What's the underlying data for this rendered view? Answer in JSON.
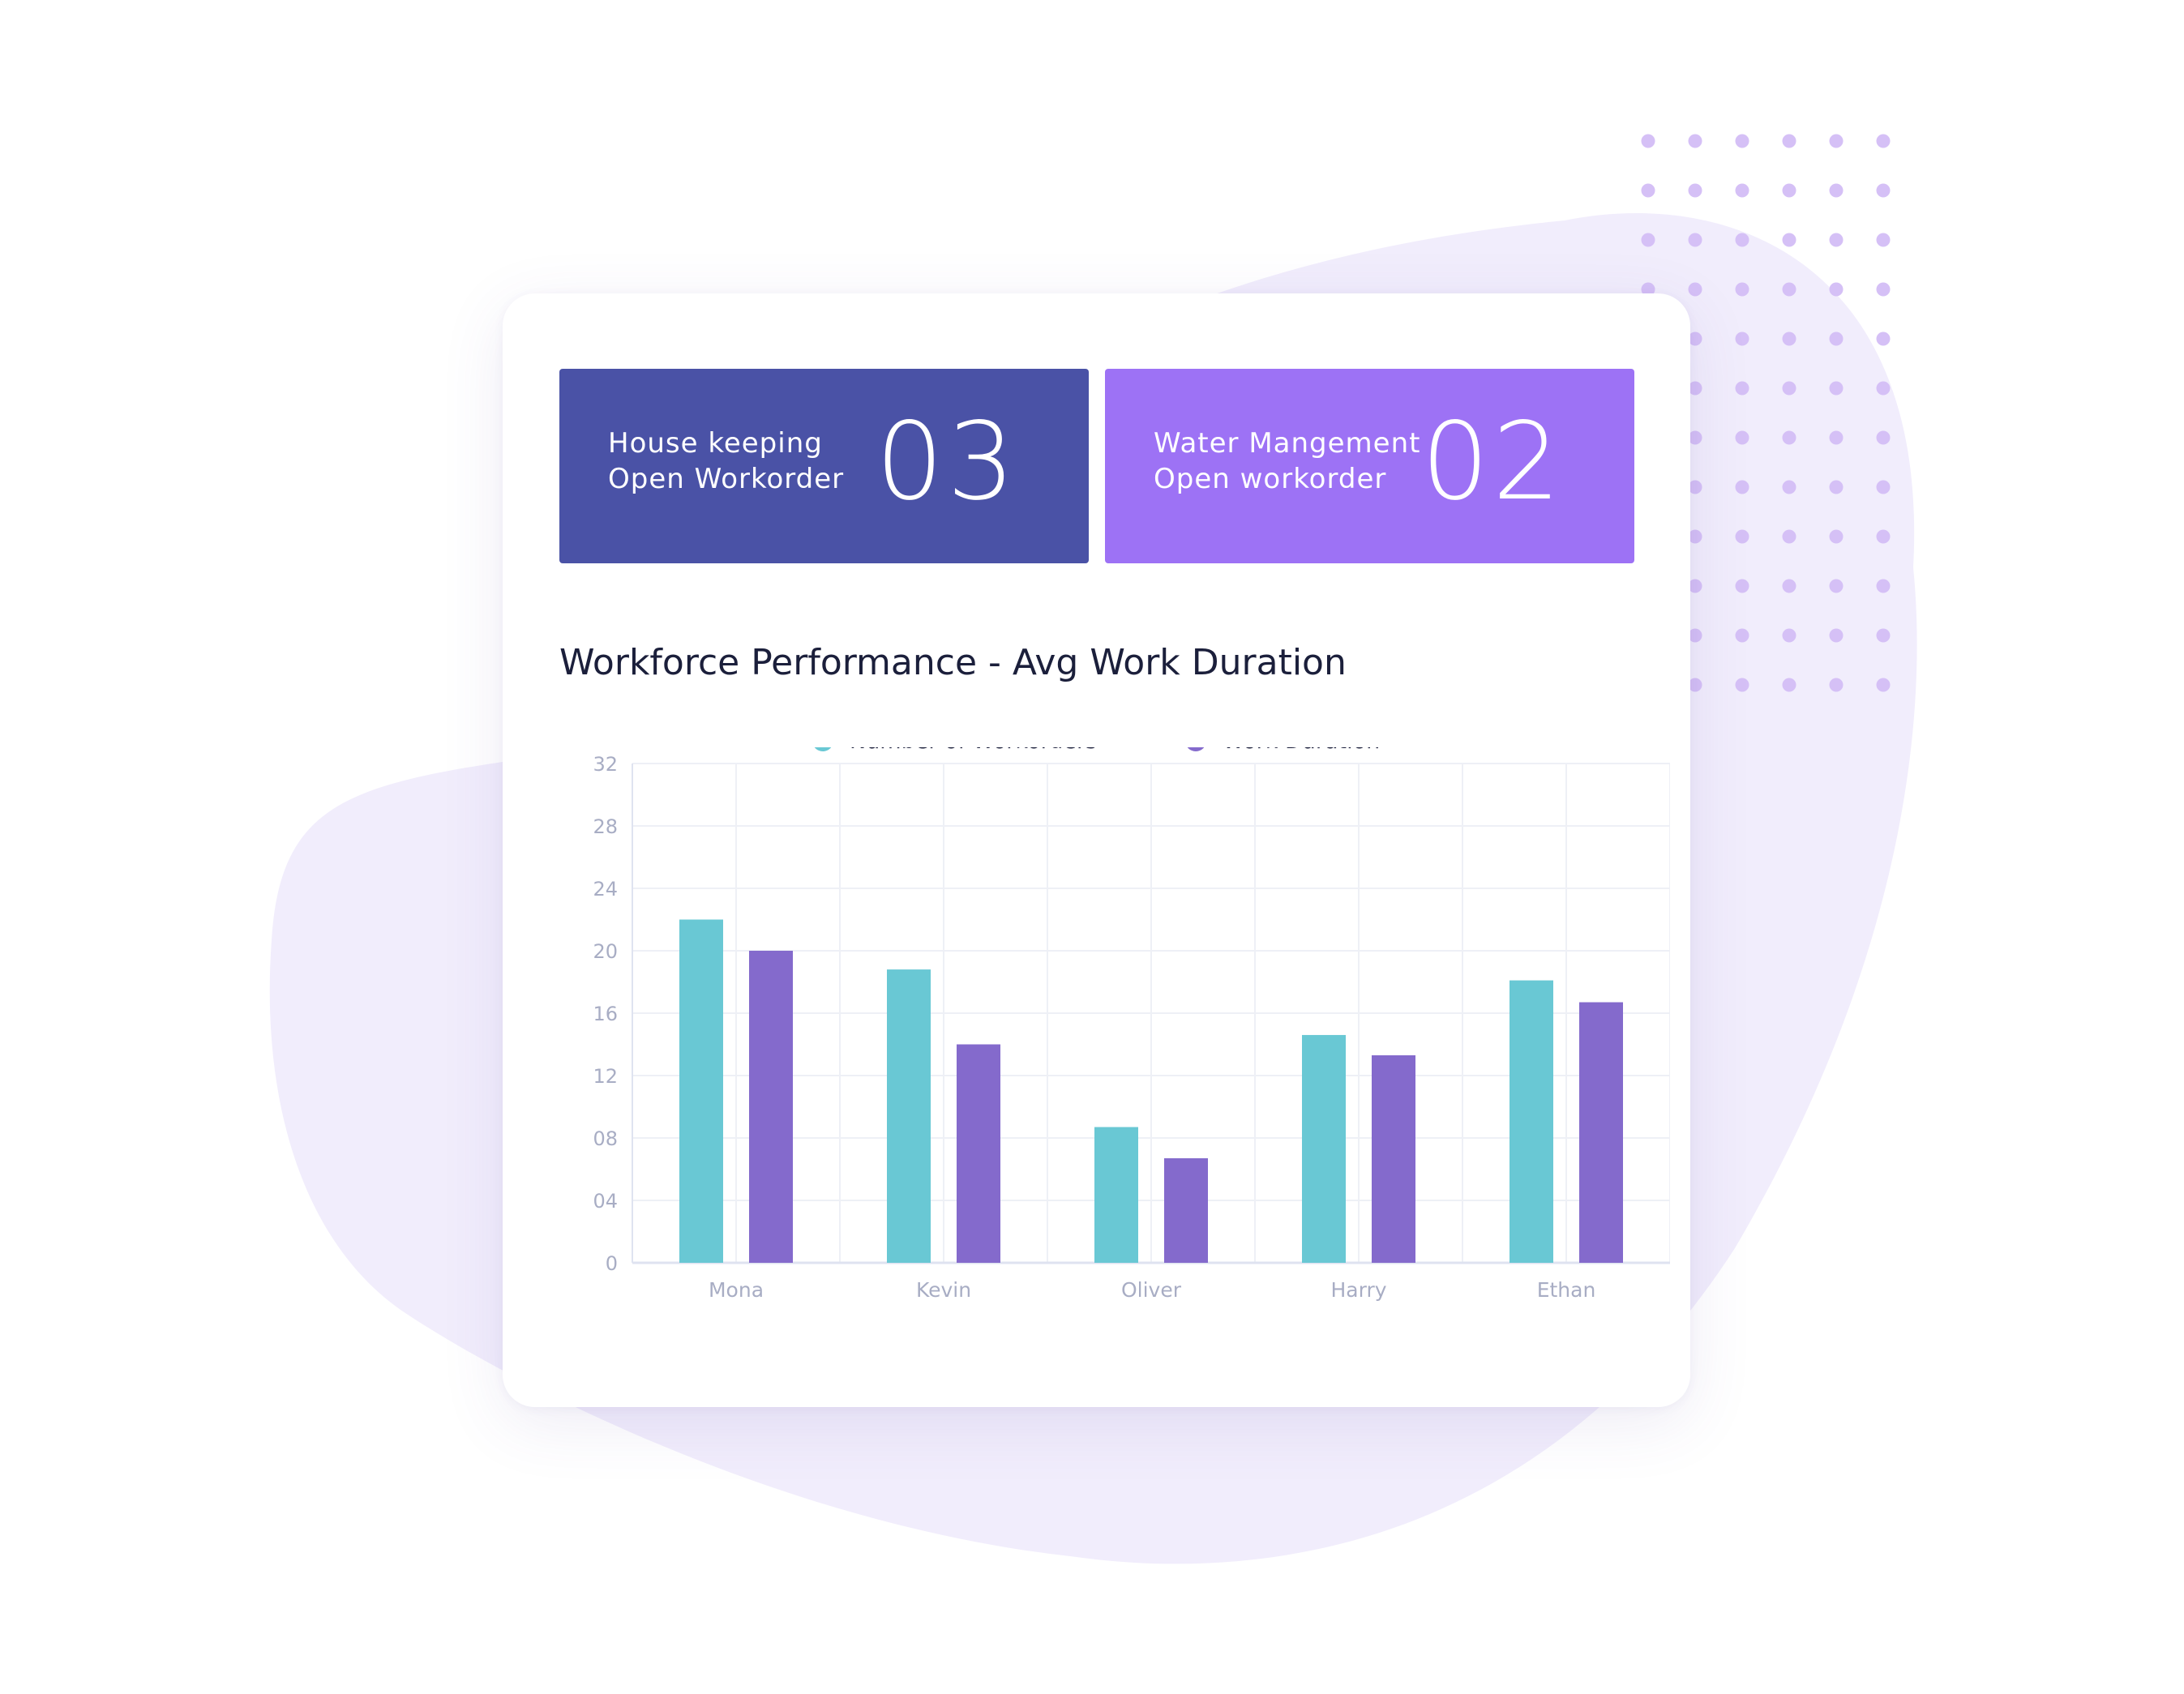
{
  "colors": {
    "background_blob": "#f1edfc",
    "dots": "#d5c0f6",
    "stat_1_bg": "#4a52a6",
    "stat_2_bg": "#9d72f5",
    "series_workorders": "#69c8d4",
    "series_duration": "#846acc",
    "axis_text": "#a8adc4",
    "grid": "#eef0f6"
  },
  "stats": [
    {
      "line1": "House keeping",
      "line2": "Open Workorder",
      "value": "03"
    },
    {
      "line1": "Water Mangement",
      "line2": "Open workorder",
      "value": "02"
    }
  ],
  "chart_data": {
    "type": "bar",
    "title": "Workforce Performance - Avg Work Duration",
    "categories": [
      "Mona",
      "Kevin",
      "Oliver",
      "Harry",
      "Ethan"
    ],
    "series": [
      {
        "name": "Number of Workorders",
        "values": [
          22,
          18.8,
          8.7,
          14.6,
          18.1
        ]
      },
      {
        "name": "Work Duration",
        "values": [
          20,
          14,
          6.7,
          13.3,
          16.7
        ]
      }
    ],
    "ylim": [
      0,
      32
    ],
    "yticks": [
      "0",
      "04",
      "08",
      "12",
      "16",
      "20",
      "24",
      "28",
      "32"
    ],
    "ytick_values": [
      0,
      4,
      8,
      12,
      16,
      20,
      24,
      28,
      32
    ],
    "grid": true,
    "legend": "top-center"
  }
}
